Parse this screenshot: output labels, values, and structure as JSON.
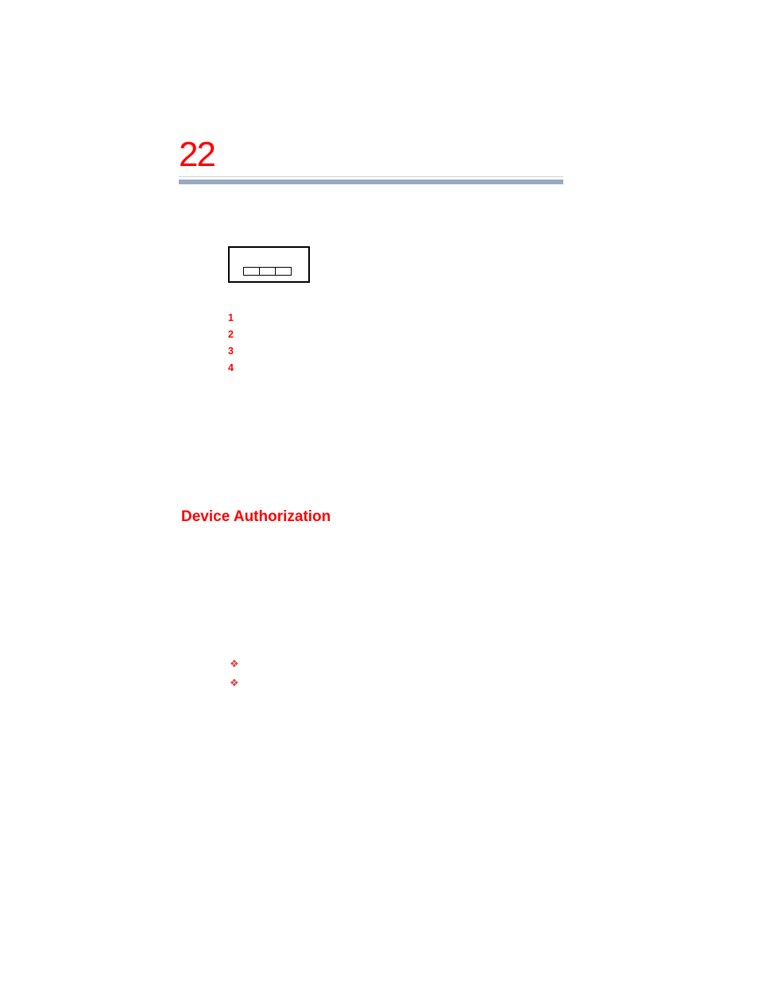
{
  "chapter_number": "22",
  "list_numbers": [
    "1",
    "2",
    "3",
    "4"
  ],
  "section_heading": "Device Authorization",
  "bullets": [
    "",
    ""
  ]
}
